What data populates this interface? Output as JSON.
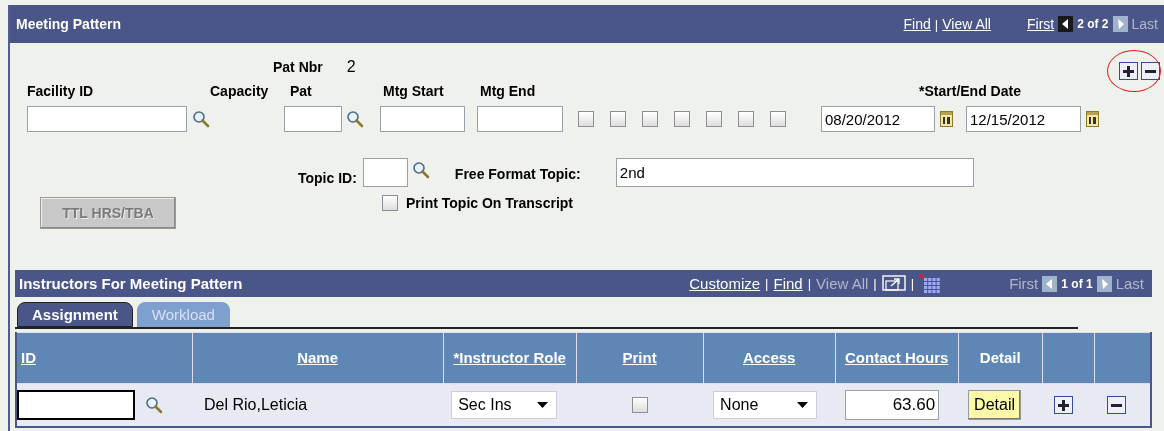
{
  "panel": {
    "title": "Meeting Pattern",
    "separator": "|",
    "links": [
      "Find",
      "View All"
    ],
    "nav": {
      "first": "First",
      "first_enabled": true,
      "position": "2 of 2",
      "last": "Last",
      "last_enabled": false
    }
  },
  "pattern_number": {
    "label": "Pat Nbr",
    "value": "2"
  },
  "row_actions": {
    "add_highlighted": true
  },
  "facility": {
    "label": "Facility ID"
  },
  "capacity": {
    "label": "Capacity"
  },
  "pat": {
    "label": "Pat"
  },
  "mtg_start": {
    "label": "Mtg Start"
  },
  "mtg_end": {
    "label": "Mtg End"
  },
  "days": [
    {
      "checked": false
    },
    {
      "checked": false
    },
    {
      "checked": false
    },
    {
      "checked": false
    },
    {
      "checked": false
    },
    {
      "checked": false
    },
    {
      "checked": false
    }
  ],
  "dates": {
    "label": "*Start/End Date",
    "start": "08/20/2012",
    "end": "12/15/2012"
  },
  "ttl_button": {
    "label": "TTL HRS/TBA",
    "disabled": true
  },
  "topic_id": {
    "label": "Topic ID:"
  },
  "free_format_topic": {
    "label": "Free Format Topic:",
    "value": "2nd"
  },
  "print_topic": {
    "label": "Print Topic On Transcript",
    "checked": false
  },
  "instructors": {
    "title": "Instructors For Meeting Pattern",
    "separator": "|",
    "links": [
      {
        "label": "Customize",
        "disabled": false
      },
      {
        "label": "Find",
        "disabled": false
      },
      {
        "label": "View All",
        "disabled": true
      }
    ],
    "nav": {
      "first": "First",
      "first_enabled": false,
      "position": "1 of 1",
      "last": "Last",
      "last_enabled": false
    },
    "tabs": [
      {
        "label": "Assignment",
        "selected": true
      },
      {
        "label": "Workload",
        "selected": false
      }
    ],
    "columns": [
      {
        "label": "ID",
        "link": true
      },
      {
        "label": "Name",
        "link": true
      },
      {
        "label": "*Instructor Role",
        "link": true
      },
      {
        "label": "Print",
        "link": true
      },
      {
        "label": "Access",
        "link": true
      },
      {
        "label": "Contact Hours",
        "link": true
      },
      {
        "label": "Detail",
        "link": false
      }
    ],
    "rows": [
      {
        "name": "Del Rio,Leticia",
        "role": "Sec Ins",
        "print": false,
        "access": "None",
        "contact_hours": "63.60",
        "detail_button": "Detail"
      }
    ]
  }
}
